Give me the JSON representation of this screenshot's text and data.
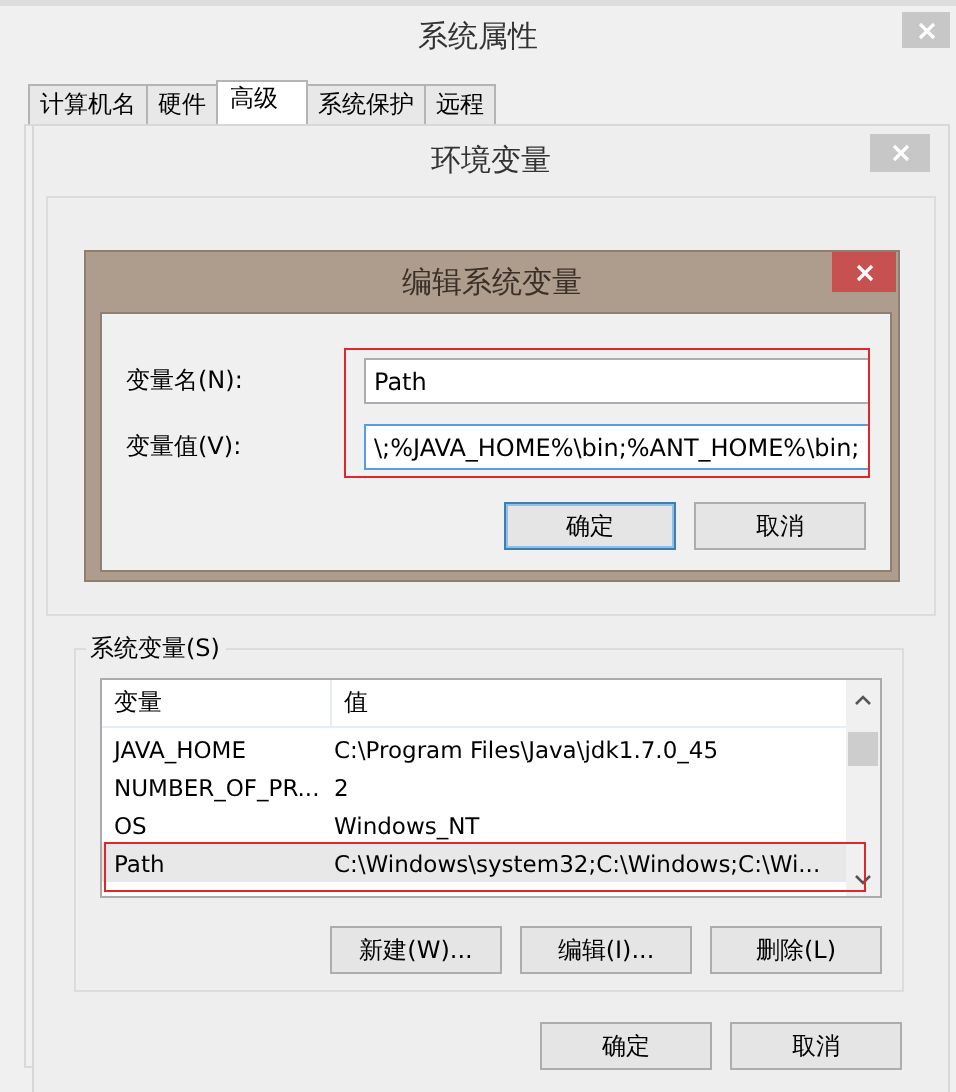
{
  "system_properties": {
    "title": "系统属性",
    "tabs": [
      {
        "label": "计算机名",
        "selected": false
      },
      {
        "label": "硬件",
        "selected": false
      },
      {
        "label": "高级",
        "selected": true
      },
      {
        "label": "系统保护",
        "selected": false
      },
      {
        "label": "远程",
        "selected": false
      }
    ]
  },
  "environment_variables": {
    "title": "环境变量",
    "system_variables": {
      "label": "系统变量(S)",
      "columns": [
        "变量",
        "值"
      ],
      "rows": [
        {
          "name": "JAVA_HOME",
          "value": "C:\\Program Files\\Java\\jdk1.7.0_45",
          "selected": false
        },
        {
          "name": "NUMBER_OF_PR...",
          "value": "2",
          "selected": false
        },
        {
          "name": "OS",
          "value": "Windows_NT",
          "selected": false
        },
        {
          "name": "Path",
          "value": "C:\\Windows\\system32;C:\\Windows;C:\\Wi...",
          "selected": true
        }
      ],
      "buttons": [
        "新建(W)...",
        "编辑(I)...",
        "删除(L)"
      ]
    },
    "buttons": [
      "确定",
      "取消"
    ]
  },
  "edit_dialog": {
    "title": "编辑系统变量",
    "fields": [
      {
        "label": "变量名(N):",
        "value": "Path",
        "focused": false
      },
      {
        "label": "变量值(V):",
        "value": "\\;%JAVA_HOME%\\bin;%ANT_HOME%\\bin;",
        "focused": true
      }
    ],
    "buttons": [
      {
        "label": "确定",
        "default": true
      },
      {
        "label": "取消",
        "default": false
      }
    ]
  }
}
